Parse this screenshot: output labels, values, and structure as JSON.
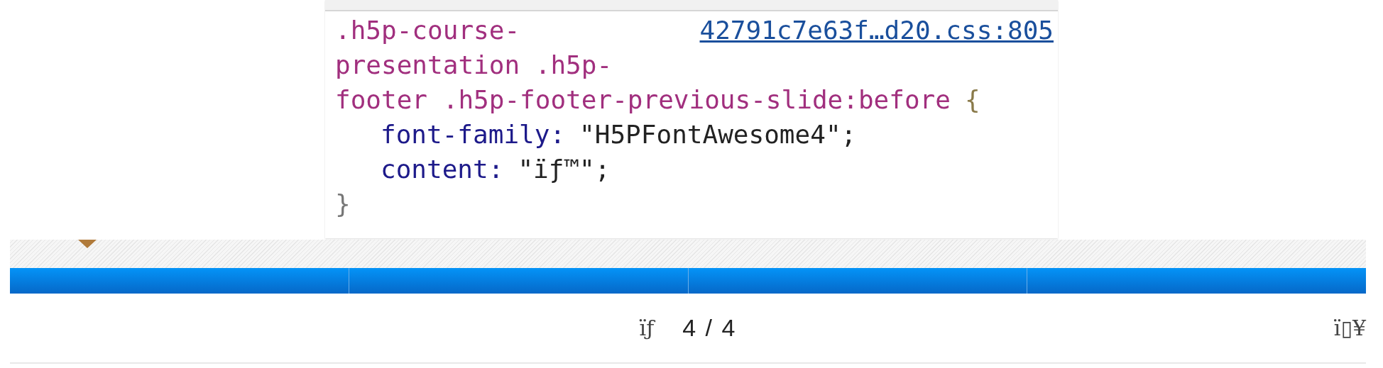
{
  "devtools_rule": {
    "selector_lines": [
      ".h5p-course-",
      "presentation .h5p-",
      "footer .h5p-footer-previous-slide:before"
    ],
    "open_brace": "{",
    "source_link": "42791c7e63f…d20.css:805",
    "declarations": [
      {
        "property": "font-family:",
        "value": "\"H5PFontAwesome4\";"
      },
      {
        "property": "content:",
        "value": "\"ïƒ™\";"
      }
    ],
    "close_brace": "}"
  },
  "progress_segments": [
    {
      "done": true
    },
    {
      "done": true
    },
    {
      "done": true
    },
    {
      "done": true
    }
  ],
  "footer": {
    "previous_glyph": "ïƒ",
    "slide_counter": "4 / 4",
    "fullscreen_glyph": "ï▯¥"
  }
}
